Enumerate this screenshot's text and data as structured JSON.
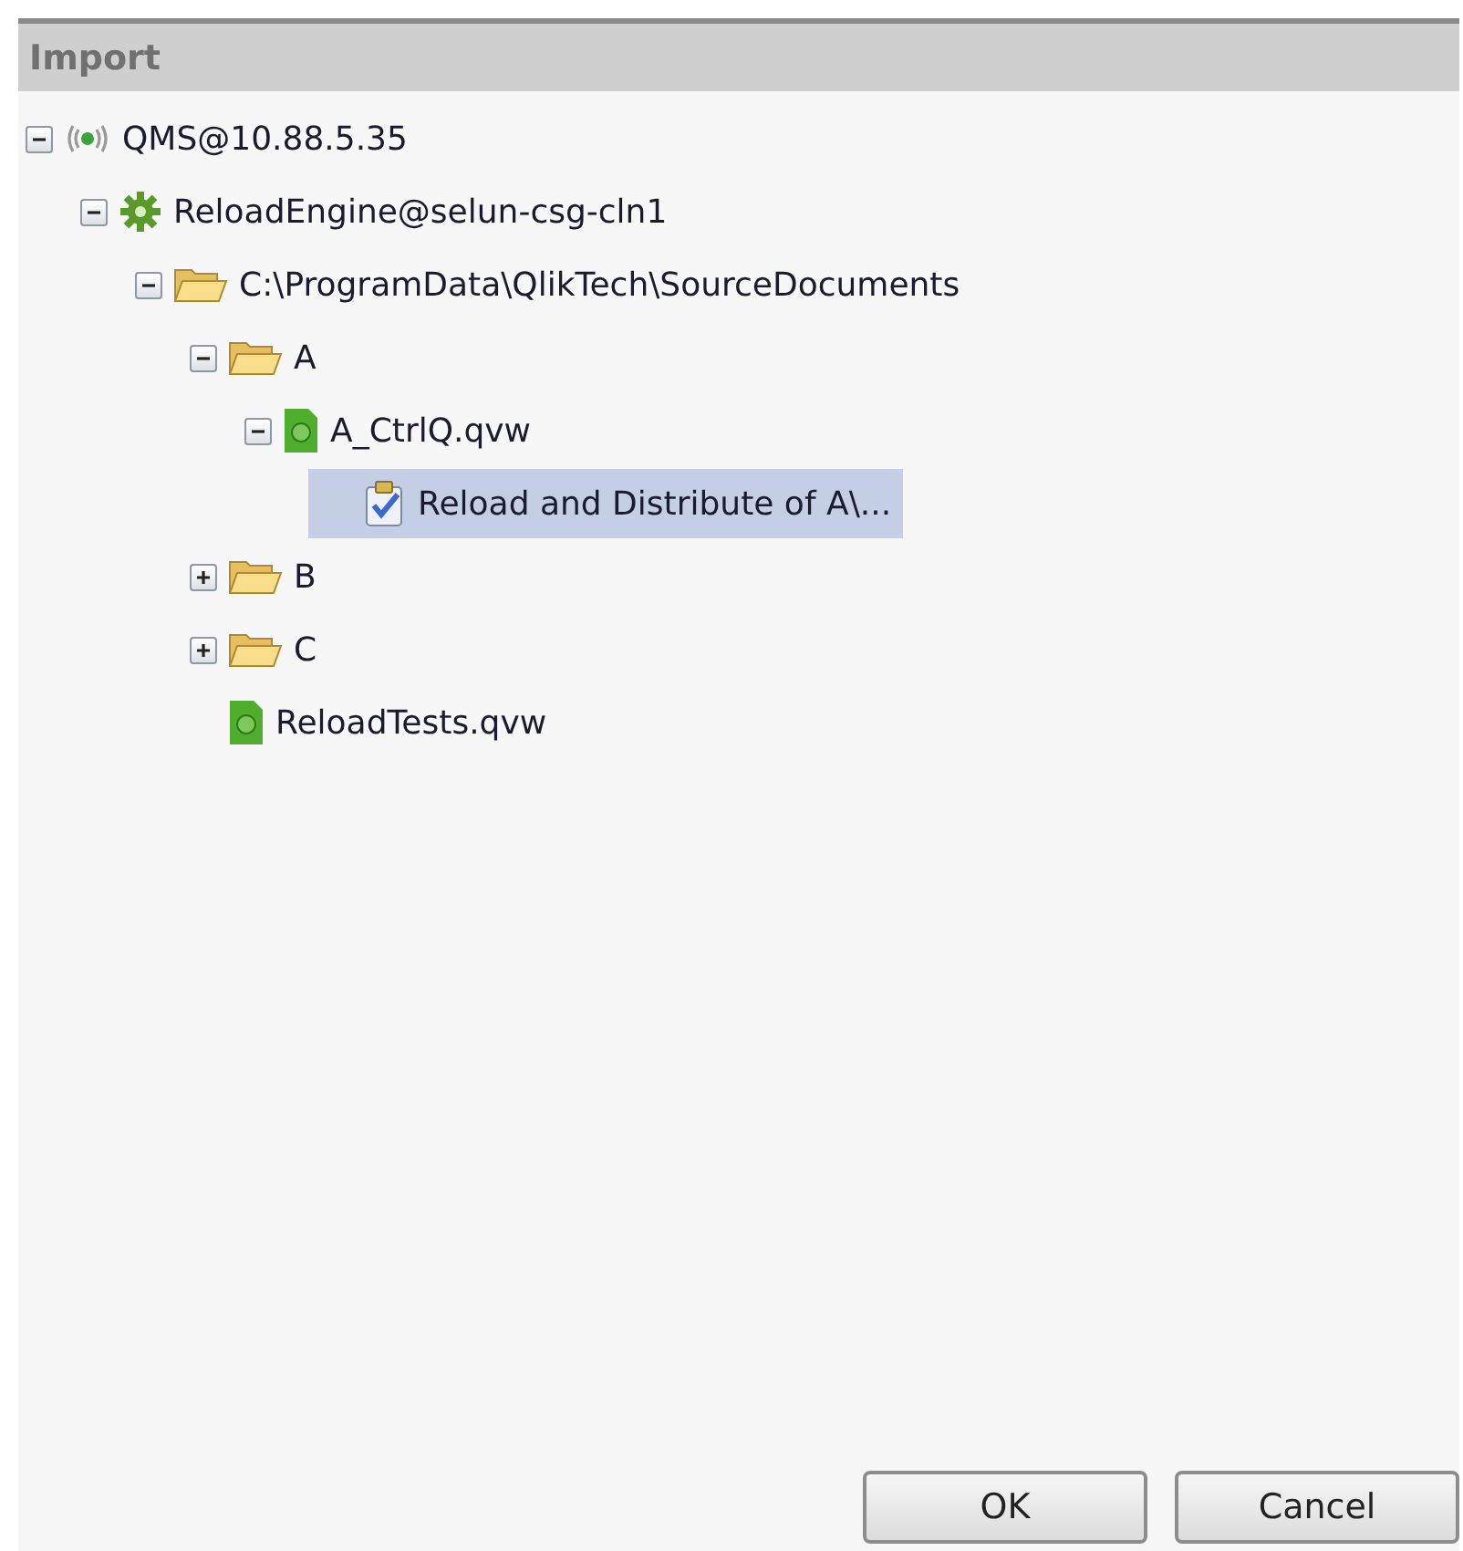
{
  "window": {
    "title": "Import"
  },
  "tree": [
    {
      "kind": "server",
      "label": "QMS@10.88.5.35",
      "expanded": true,
      "selected": false,
      "children": [
        {
          "kind": "engine",
          "label": "ReloadEngine@selun-csg-cln1",
          "expanded": true,
          "selected": false,
          "children": [
            {
              "kind": "folder",
              "label": "C:\\ProgramData\\QlikTech\\SourceDocuments",
              "expanded": true,
              "selected": false,
              "children": [
                {
                  "kind": "folder",
                  "label": "A",
                  "expanded": true,
                  "selected": false,
                  "children": [
                    {
                      "kind": "document",
                      "label": "A_CtrlQ.qvw",
                      "expanded": true,
                      "selected": false,
                      "children": [
                        {
                          "kind": "task",
                          "label": "Reload and Distribute of A\\...",
                          "selected": true
                        }
                      ]
                    }
                  ]
                },
                {
                  "kind": "folder",
                  "label": "B",
                  "expanded": false,
                  "selected": false
                },
                {
                  "kind": "folder",
                  "label": "C",
                  "expanded": false,
                  "selected": false
                },
                {
                  "kind": "document",
                  "label": "ReloadTests.qvw",
                  "selected": false
                }
              ]
            }
          ]
        }
      ]
    }
  ],
  "buttons": [
    "OK",
    "Cancel"
  ]
}
